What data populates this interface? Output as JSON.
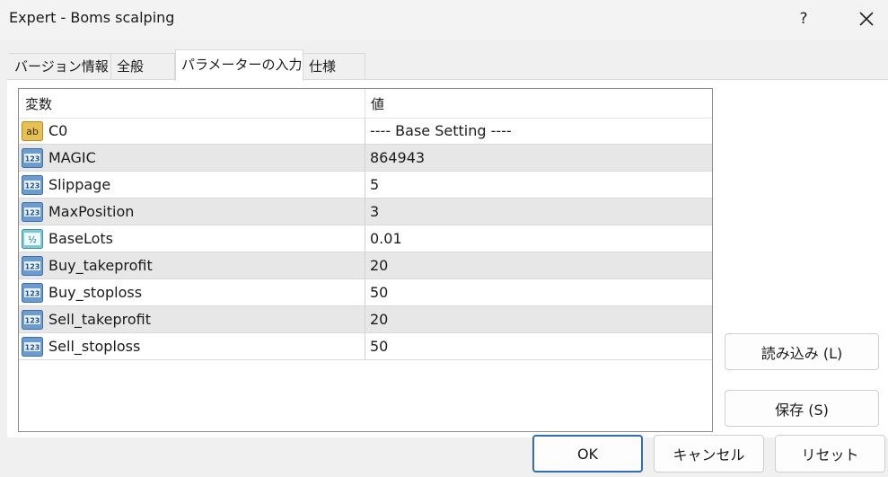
{
  "window": {
    "title": "Expert - Boms scalping",
    "help_label": "?"
  },
  "tabs": [
    {
      "label": "バージョン情報",
      "active": false
    },
    {
      "label": "全般",
      "active": false
    },
    {
      "label": "パラメーターの入力",
      "active": true
    },
    {
      "label": "仕様",
      "active": false
    }
  ],
  "grid": {
    "headers": {
      "name": "変数",
      "value": "値"
    },
    "rows": [
      {
        "name": "C0",
        "value": "---- Base Setting ----",
        "type_icon": "string-ab-icon"
      },
      {
        "name": "MAGIC",
        "value": "864943",
        "type_icon": "integer-123-icon"
      },
      {
        "name": "Slippage",
        "value": "5",
        "type_icon": "integer-123-icon"
      },
      {
        "name": "MaxPosition",
        "value": "3",
        "type_icon": "integer-123-icon"
      },
      {
        "name": "BaseLots",
        "value": "0.01",
        "type_icon": "double-half-icon"
      },
      {
        "name": "Buy_takeprofit",
        "value": "20",
        "type_icon": "integer-123-icon"
      },
      {
        "name": "Buy_stoploss",
        "value": "50",
        "type_icon": "integer-123-icon"
      },
      {
        "name": "Sell_takeprofit",
        "value": "20",
        "type_icon": "integer-123-icon"
      },
      {
        "name": "Sell_stoploss",
        "value": "50",
        "type_icon": "integer-123-icon"
      }
    ]
  },
  "buttons": {
    "load": "読み込み (L)",
    "save": "保存 (S)",
    "ok": "OK",
    "cancel": "キャンセル",
    "reset": "リセット"
  },
  "colors": {
    "primary_border": "#2f6db5",
    "string_icon": "#e0b84a",
    "integer_icon": "#4f86c6",
    "double_icon": "#5fb8c8",
    "alt_row": "#e7e7e7"
  }
}
